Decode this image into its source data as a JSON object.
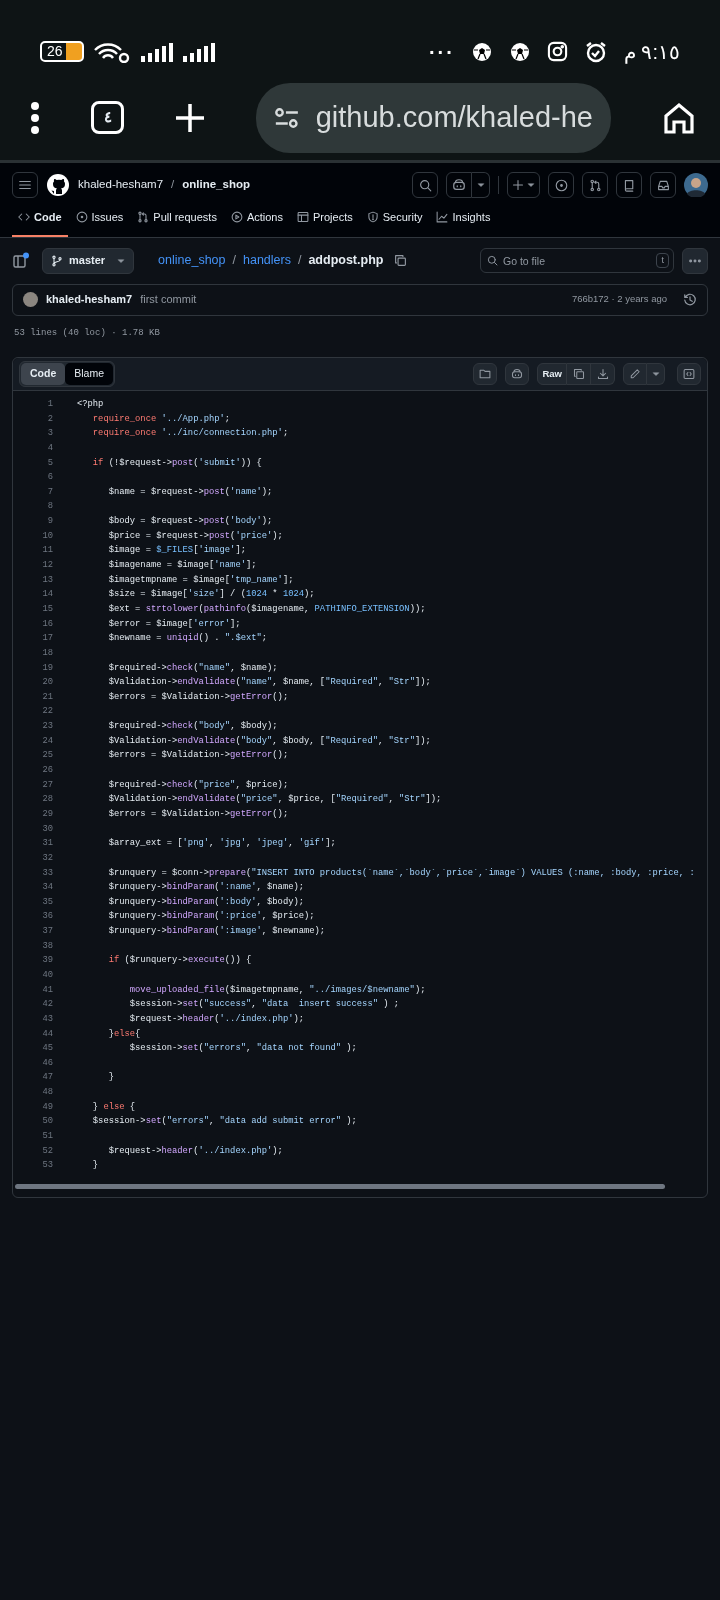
{
  "status_bar": {
    "battery": "26",
    "more": "···",
    "time": "٩:١٥ م"
  },
  "browser": {
    "tab_count": "٤",
    "url": "github.com/khaled-he"
  },
  "header": {
    "owner": "khaled-hesham7",
    "separator": "/",
    "repo": "online_shop"
  },
  "tabs": [
    {
      "label": "Code",
      "selected": true
    },
    {
      "label": "Issues",
      "selected": false
    },
    {
      "label": "Pull requests",
      "selected": false
    },
    {
      "label": "Actions",
      "selected": false
    },
    {
      "label": "Projects",
      "selected": false
    },
    {
      "label": "Security",
      "selected": false
    },
    {
      "label": "Insights",
      "selected": false
    }
  ],
  "file_nav": {
    "branch": "master",
    "breadcrumb": [
      {
        "label": "online_shop",
        "kind": "link"
      },
      {
        "label": "/",
        "kind": "sep"
      },
      {
        "label": "handlers",
        "kind": "link"
      },
      {
        "label": "/",
        "kind": "sep"
      },
      {
        "label": "addpost.php",
        "kind": "current"
      }
    ],
    "search": {
      "placeholder": "Go to file",
      "shortcut": "t"
    }
  },
  "commit": {
    "author": "khaled-hesham7",
    "message": "first commit",
    "sha_time": "766b172 · 2 years ago"
  },
  "file_info": "53 lines (40 loc) · 1.78 KB",
  "view_toggle": [
    {
      "label": "Code",
      "selected": true
    },
    {
      "label": "Blame",
      "selected": false
    }
  ],
  "raw_button": "Raw",
  "code": {
    "lines": [
      {
        "number": "1",
        "tokens": [
          {
            "text": "<?php",
            "kind": "plain"
          }
        ]
      },
      {
        "number": "2",
        "tokens": [
          {
            "text": "   require_once",
            "kind": "keyword"
          },
          {
            "text": " '../App.php'",
            "kind": "string"
          },
          {
            "text": ";",
            "kind": "plain"
          }
        ]
      },
      {
        "number": "3",
        "tokens": [
          {
            "text": "   require_once",
            "kind": "keyword"
          },
          {
            "text": " '../inc/connection.php'",
            "kind": "string"
          },
          {
            "text": ";",
            "kind": "plain"
          }
        ]
      },
      {
        "number": "4"
      },
      {
        "number": "5",
        "tokens": [
          {
            "text": "   if",
            "kind": "keyword"
          },
          {
            "text": " (!$request->",
            "kind": "plain"
          },
          {
            "text": "post",
            "kind": "function"
          },
          {
            "text": "(",
            "kind": "plain"
          },
          {
            "text": "'submit'",
            "kind": "string"
          },
          {
            "text": ")) {",
            "kind": "plain"
          }
        ]
      },
      {
        "number": "6"
      },
      {
        "number": "7",
        "tokens": [
          {
            "text": "      $name = $request->",
            "kind": "plain"
          },
          {
            "text": "post",
            "kind": "function"
          },
          {
            "text": "(",
            "kind": "plain"
          },
          {
            "text": "'name'",
            "kind": "string"
          },
          {
            "text": ");",
            "kind": "plain"
          }
        ]
      },
      {
        "number": "8"
      },
      {
        "number": "9",
        "tokens": [
          {
            "text": "      $body = $request->",
            "kind": "plain"
          },
          {
            "text": "post",
            "kind": "function"
          },
          {
            "text": "(",
            "kind": "plain"
          },
          {
            "text": "'body'",
            "kind": "string"
          },
          {
            "text": ");",
            "kind": "plain"
          }
        ]
      },
      {
        "number": "10",
        "tokens": [
          {
            "text": "      $price = $request->",
            "kind": "plain"
          },
          {
            "text": "post",
            "kind": "function"
          },
          {
            "text": "(",
            "kind": "plain"
          },
          {
            "text": "'price'",
            "kind": "string"
          },
          {
            "text": ");",
            "kind": "plain"
          }
        ]
      },
      {
        "number": "11",
        "tokens": [
          {
            "text": "      $image = ",
            "kind": "plain"
          },
          {
            "text": "$_FILES",
            "kind": "constant"
          },
          {
            "text": "[",
            "kind": "plain"
          },
          {
            "text": "'image'",
            "kind": "string"
          },
          {
            "text": "];",
            "kind": "plain"
          }
        ]
      },
      {
        "number": "12",
        "tokens": [
          {
            "text": "      $imagename = $image[",
            "kind": "plain"
          },
          {
            "text": "'name'",
            "kind": "string"
          },
          {
            "text": "];",
            "kind": "plain"
          }
        ]
      },
      {
        "number": "13",
        "tokens": [
          {
            "text": "      $imagetmpname = $image[",
            "kind": "plain"
          },
          {
            "text": "'tmp_name'",
            "kind": "string"
          },
          {
            "text": "];",
            "kind": "plain"
          }
        ]
      },
      {
        "number": "14",
        "tokens": [
          {
            "text": "      $size = $image[",
            "kind": "plain"
          },
          {
            "text": "'size'",
            "kind": "string"
          },
          {
            "text": "] / (",
            "kind": "plain"
          },
          {
            "text": "1024",
            "kind": "constant"
          },
          {
            "text": " * ",
            "kind": "plain"
          },
          {
            "text": "1024",
            "kind": "constant"
          },
          {
            "text": ");",
            "kind": "plain"
          }
        ]
      },
      {
        "number": "15",
        "tokens": [
          {
            "text": "      $ext = ",
            "kind": "plain"
          },
          {
            "text": "strtolower",
            "kind": "function"
          },
          {
            "text": "(",
            "kind": "plain"
          },
          {
            "text": "pathinfo",
            "kind": "function"
          },
          {
            "text": "($imagename, ",
            "kind": "plain"
          },
          {
            "text": "PATHINFO_EXTENSION",
            "kind": "constant"
          },
          {
            "text": "));",
            "kind": "plain"
          }
        ]
      },
      {
        "number": "16",
        "tokens": [
          {
            "text": "      $error = $image[",
            "kind": "plain"
          },
          {
            "text": "'error'",
            "kind": "string"
          },
          {
            "text": "];",
            "kind": "plain"
          }
        ]
      },
      {
        "number": "17",
        "tokens": [
          {
            "text": "      $newname = ",
            "kind": "plain"
          },
          {
            "text": "uniqid",
            "kind": "function"
          },
          {
            "text": "() . ",
            "kind": "plain"
          },
          {
            "text": "\".$ext\"",
            "kind": "string"
          },
          {
            "text": ";",
            "kind": "plain"
          }
        ]
      },
      {
        "number": "18"
      },
      {
        "number": "19",
        "tokens": [
          {
            "text": "      $required->",
            "kind": "plain"
          },
          {
            "text": "check",
            "kind": "function"
          },
          {
            "text": "(",
            "kind": "plain"
          },
          {
            "text": "\"name\"",
            "kind": "string"
          },
          {
            "text": ", $name);",
            "kind": "plain"
          }
        ]
      },
      {
        "number": "20",
        "tokens": [
          {
            "text": "      $Validation->",
            "kind": "plain"
          },
          {
            "text": "endValidate",
            "kind": "function"
          },
          {
            "text": "(",
            "kind": "plain"
          },
          {
            "text": "\"name\"",
            "kind": "string"
          },
          {
            "text": ", $name, [",
            "kind": "plain"
          },
          {
            "text": "\"Required\"",
            "kind": "string"
          },
          {
            "text": ", ",
            "kind": "plain"
          },
          {
            "text": "\"Str\"",
            "kind": "string"
          },
          {
            "text": "]);",
            "kind": "plain"
          }
        ]
      },
      {
        "number": "21",
        "tokens": [
          {
            "text": "      $errors = $Validation->",
            "kind": "plain"
          },
          {
            "text": "getError",
            "kind": "function"
          },
          {
            "text": "();",
            "kind": "plain"
          }
        ]
      },
      {
        "number": "22"
      },
      {
        "number": "23",
        "tokens": [
          {
            "text": "      $required->",
            "kind": "plain"
          },
          {
            "text": "check",
            "kind": "function"
          },
          {
            "text": "(",
            "kind": "plain"
          },
          {
            "text": "\"body\"",
            "kind": "string"
          },
          {
            "text": ", $body);",
            "kind": "plain"
          }
        ]
      },
      {
        "number": "24",
        "tokens": [
          {
            "text": "      $Validation->",
            "kind": "plain"
          },
          {
            "text": "endValidate",
            "kind": "function"
          },
          {
            "text": "(",
            "kind": "plain"
          },
          {
            "text": "\"body\"",
            "kind": "string"
          },
          {
            "text": ", $body, [",
            "kind": "plain"
          },
          {
            "text": "\"Required\"",
            "kind": "string"
          },
          {
            "text": ", ",
            "kind": "plain"
          },
          {
            "text": "\"Str\"",
            "kind": "string"
          },
          {
            "text": "]);",
            "kind": "plain"
          }
        ]
      },
      {
        "number": "25",
        "tokens": [
          {
            "text": "      $errors = $Validation->",
            "kind": "plain"
          },
          {
            "text": "getError",
            "kind": "function"
          },
          {
            "text": "();",
            "kind": "plain"
          }
        ]
      },
      {
        "number": "26"
      },
      {
        "number": "27",
        "tokens": [
          {
            "text": "      $required->",
            "kind": "plain"
          },
          {
            "text": "check",
            "kind": "function"
          },
          {
            "text": "(",
            "kind": "plain"
          },
          {
            "text": "\"price\"",
            "kind": "string"
          },
          {
            "text": ", $price);",
            "kind": "plain"
          }
        ]
      },
      {
        "number": "28",
        "tokens": [
          {
            "text": "      $Validation->",
            "kind": "plain"
          },
          {
            "text": "endValidate",
            "kind": "function"
          },
          {
            "text": "(",
            "kind": "plain"
          },
          {
            "text": "\"price\"",
            "kind": "string"
          },
          {
            "text": ", $price, [",
            "kind": "plain"
          },
          {
            "text": "\"Required\"",
            "kind": "string"
          },
          {
            "text": ", ",
            "kind": "plain"
          },
          {
            "text": "\"Str\"",
            "kind": "string"
          },
          {
            "text": "]);",
            "kind": "plain"
          }
        ]
      },
      {
        "number": "29",
        "tokens": [
          {
            "text": "      $errors = $Validation->",
            "kind": "plain"
          },
          {
            "text": "getError",
            "kind": "function"
          },
          {
            "text": "();",
            "kind": "plain"
          }
        ]
      },
      {
        "number": "30"
      },
      {
        "number": "31",
        "tokens": [
          {
            "text": "      $array_ext = [",
            "kind": "plain"
          },
          {
            "text": "'png'",
            "kind": "string"
          },
          {
            "text": ", ",
            "kind": "plain"
          },
          {
            "text": "'jpg'",
            "kind": "string"
          },
          {
            "text": ", ",
            "kind": "plain"
          },
          {
            "text": "'jpeg'",
            "kind": "string"
          },
          {
            "text": ", ",
            "kind": "plain"
          },
          {
            "text": "'gif'",
            "kind": "string"
          },
          {
            "text": "];",
            "kind": "plain"
          }
        ]
      },
      {
        "number": "32"
      },
      {
        "number": "33",
        "tokens": [
          {
            "text": "      $runquery = $conn->",
            "kind": "plain"
          },
          {
            "text": "prepare",
            "kind": "function"
          },
          {
            "text": "(",
            "kind": "plain"
          },
          {
            "text": "\"INSERT INTO products(`name`,`body`,`price`,`image`) VALUES (:name, :body, :price, :",
            "kind": "string"
          }
        ]
      },
      {
        "number": "34",
        "tokens": [
          {
            "text": "      $runquery->",
            "kind": "plain"
          },
          {
            "text": "bindParam",
            "kind": "function"
          },
          {
            "text": "(",
            "kind": "plain"
          },
          {
            "text": "':name'",
            "kind": "string"
          },
          {
            "text": ", $name);",
            "kind": "plain"
          }
        ]
      },
      {
        "number": "35",
        "tokens": [
          {
            "text": "      $runquery->",
            "kind": "plain"
          },
          {
            "text": "bindParam",
            "kind": "function"
          },
          {
            "text": "(",
            "kind": "plain"
          },
          {
            "text": "':body'",
            "kind": "string"
          },
          {
            "text": ", $body);",
            "kind": "plain"
          }
        ]
      },
      {
        "number": "36",
        "tokens": [
          {
            "text": "      $runquery->",
            "kind": "plain"
          },
          {
            "text": "bindParam",
            "kind": "function"
          },
          {
            "text": "(",
            "kind": "plain"
          },
          {
            "text": "':price'",
            "kind": "string"
          },
          {
            "text": ", $price);",
            "kind": "plain"
          }
        ]
      },
      {
        "number": "37",
        "tokens": [
          {
            "text": "      $runquery->",
            "kind": "plain"
          },
          {
            "text": "bindParam",
            "kind": "function"
          },
          {
            "text": "(",
            "kind": "plain"
          },
          {
            "text": "':image'",
            "kind": "string"
          },
          {
            "text": ", $newname);",
            "kind": "plain"
          }
        ]
      },
      {
        "number": "38"
      },
      {
        "number": "39",
        "tokens": [
          {
            "text": "      if",
            "kind": "keyword"
          },
          {
            "text": " ($runquery->",
            "kind": "plain"
          },
          {
            "text": "execute",
            "kind": "function"
          },
          {
            "text": "()) {",
            "kind": "plain"
          }
        ]
      },
      {
        "number": "40"
      },
      {
        "number": "41",
        "tokens": [
          {
            "text": "          move_uploaded_file",
            "kind": "function"
          },
          {
            "text": "($imagetmpname, ",
            "kind": "plain"
          },
          {
            "text": "\"../images/$newname\"",
            "kind": "string"
          },
          {
            "text": ");",
            "kind": "plain"
          }
        ]
      },
      {
        "number": "42",
        "tokens": [
          {
            "text": "          $session->",
            "kind": "plain"
          },
          {
            "text": "set",
            "kind": "function"
          },
          {
            "text": "(",
            "kind": "plain"
          },
          {
            "text": "\"success\"",
            "kind": "string"
          },
          {
            "text": ", ",
            "kind": "plain"
          },
          {
            "text": "\"data  insert success\"",
            "kind": "string"
          },
          {
            "text": " ) ;",
            "kind": "plain"
          }
        ]
      },
      {
        "number": "43",
        "tokens": [
          {
            "text": "          $request->",
            "kind": "plain"
          },
          {
            "text": "header",
            "kind": "function"
          },
          {
            "text": "(",
            "kind": "plain"
          },
          {
            "text": "'../index.php'",
            "kind": "string"
          },
          {
            "text": ");",
            "kind": "plain"
          }
        ]
      },
      {
        "number": "44",
        "tokens": [
          {
            "text": "      }",
            "kind": "plain"
          },
          {
            "text": "else",
            "kind": "keyword"
          },
          {
            "text": "{",
            "kind": "plain"
          }
        ]
      },
      {
        "number": "45",
        "tokens": [
          {
            "text": "          $session->",
            "kind": "plain"
          },
          {
            "text": "set",
            "kind": "function"
          },
          {
            "text": "(",
            "kind": "plain"
          },
          {
            "text": "\"errors\"",
            "kind": "string"
          },
          {
            "text": ", ",
            "kind": "plain"
          },
          {
            "text": "\"data not found\"",
            "kind": "string"
          },
          {
            "text": " );",
            "kind": "plain"
          }
        ]
      },
      {
        "number": "46"
      },
      {
        "number": "47",
        "tokens": [
          {
            "text": "      }",
            "kind": "plain"
          }
        ]
      },
      {
        "number": "48"
      },
      {
        "number": "49",
        "tokens": [
          {
            "text": "   } ",
            "kind": "plain"
          },
          {
            "text": "else",
            "kind": "keyword"
          },
          {
            "text": " {",
            "kind": "plain"
          }
        ]
      },
      {
        "number": "50",
        "tokens": [
          {
            "text": "   $session->",
            "kind": "plain"
          },
          {
            "text": "set",
            "kind": "function"
          },
          {
            "text": "(",
            "kind": "plain"
          },
          {
            "text": "\"errors\"",
            "kind": "string"
          },
          {
            "text": ", ",
            "kind": "plain"
          },
          {
            "text": "\"data add submit error\"",
            "kind": "string"
          },
          {
            "text": " );",
            "kind": "plain"
          }
        ]
      },
      {
        "number": "51"
      },
      {
        "number": "52",
        "tokens": [
          {
            "text": "      $request->",
            "kind": "plain"
          },
          {
            "text": "header",
            "kind": "function"
          },
          {
            "text": "(",
            "kind": "plain"
          },
          {
            "text": "'../index.php'",
            "kind": "string"
          },
          {
            "text": ");",
            "kind": "plain"
          }
        ]
      },
      {
        "number": "53",
        "tokens": [
          {
            "text": "   }",
            "kind": "plain"
          }
        ]
      }
    ]
  }
}
